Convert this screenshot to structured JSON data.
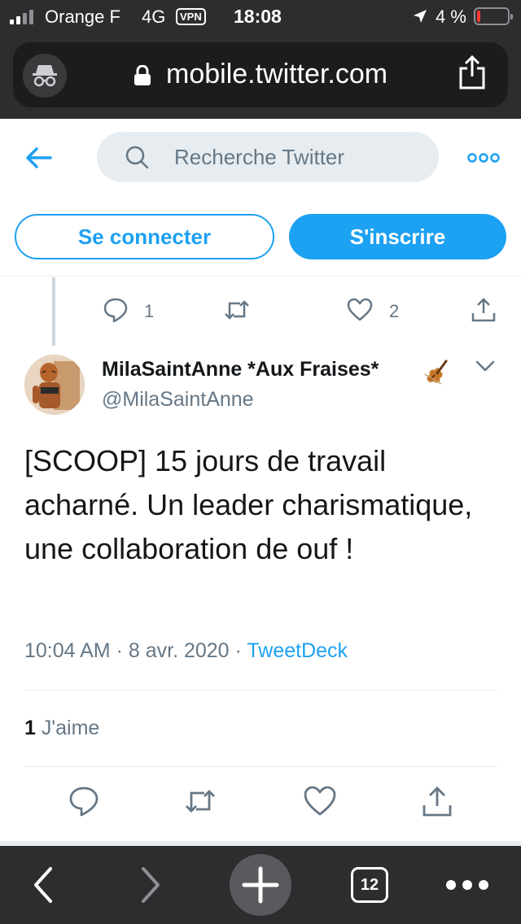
{
  "status_bar": {
    "carrier": "Orange F",
    "network": "4G",
    "vpn": "VPN",
    "time": "18:08",
    "battery_percent": "4 %",
    "battery_level": 0.04
  },
  "browser": {
    "url": "mobile.twitter.com",
    "open_tabs": "12"
  },
  "twitter_header": {
    "search_placeholder": "Recherche Twitter",
    "login_label": "Se connecter",
    "signup_label": "S'inscrire"
  },
  "previous_tweet": {
    "reply_count": "1",
    "like_count": "2"
  },
  "tweet": {
    "author_name": "MilaSaintAnne *Aux Fraises*",
    "author_handle": "@MilaSaintAnne",
    "text": "[SCOOP] 15 jours de travail acharné. Un leader charismatique, une collaboration de ouf !",
    "time": "10:04 AM",
    "date": "8 avr. 2020",
    "source": "TweetDeck",
    "separator": "·",
    "likes_count": "1",
    "likes_label": "J'aime"
  },
  "colors": {
    "twitter_blue": "#1da1f2",
    "secondary_text": "#657786",
    "chrome": "#2d2d2f"
  }
}
